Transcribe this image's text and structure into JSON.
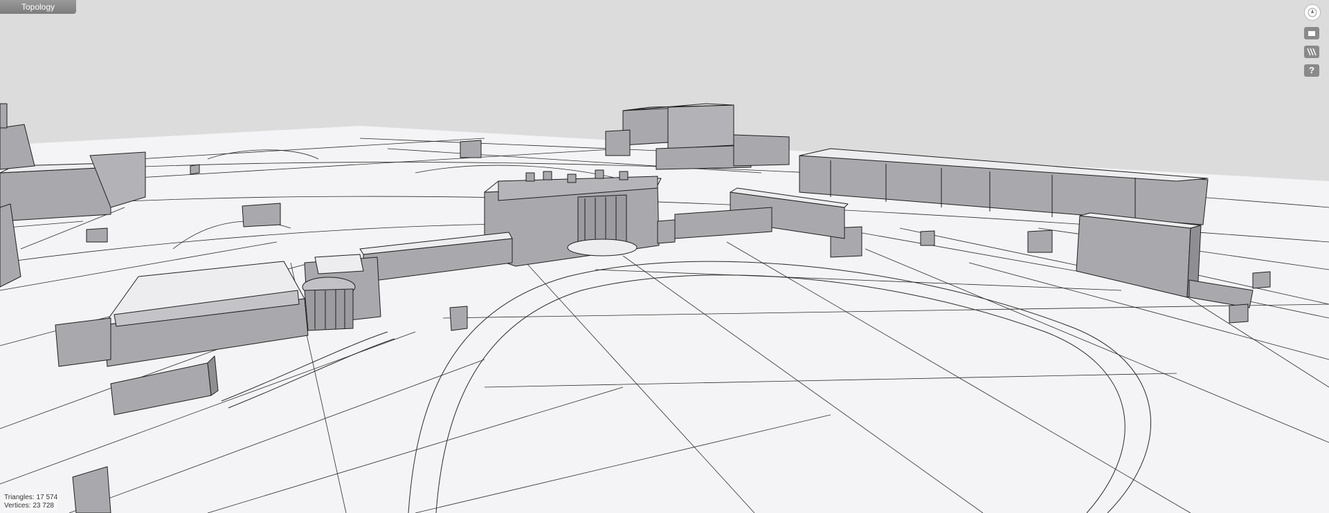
{
  "window": {
    "title": "Topology"
  },
  "toolbar": {
    "buttons": [
      {
        "icon": "compass-icon",
        "label": ""
      },
      {
        "icon": "box-view-icon",
        "label": ""
      },
      {
        "icon": "layers-icon",
        "label": ""
      },
      {
        "icon": "help-icon",
        "label": "?"
      }
    ]
  },
  "stats": {
    "triangles_label": "Triangles:",
    "triangles_value": "17 574",
    "vertices_label": "Vertices:",
    "vertices_value": "23 728"
  },
  "colors": {
    "sky": "#dcdcdc",
    "ground": "#f4f4f6",
    "building": "#a9a9ad",
    "building_top": "#ededef",
    "edges": "#1a1a1a"
  }
}
